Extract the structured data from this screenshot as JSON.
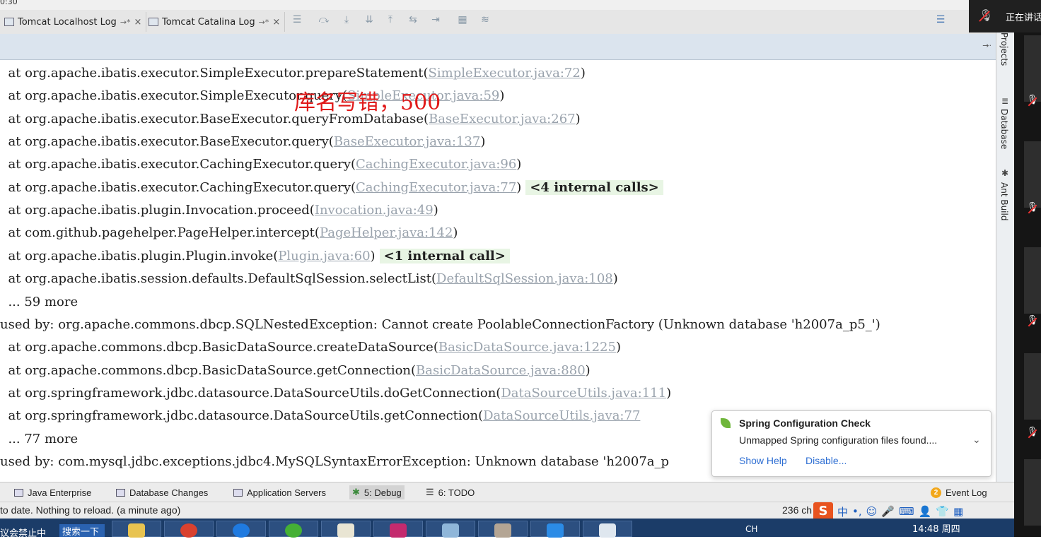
{
  "window": {
    "time_fragment": "0:30"
  },
  "tabs": [
    {
      "label": "Tomcat Localhost Log",
      "pin": "→*",
      "close": "×"
    },
    {
      "label": "Tomcat Catalina Log",
      "pin": "→*",
      "close": "×"
    }
  ],
  "console": {
    "lines": [
      {
        "text": "  at org.apache.ibatis.executor.SimpleExecutor.prepareStatement(",
        "link": "SimpleExecutor.java:72",
        "tail": ")",
        "internal": ""
      },
      {
        "text": "  at org.apache.ibatis.executor.SimpleExecutor.query(",
        "link": "SimpleExecutor.java:59",
        "tail": ")",
        "internal": ""
      },
      {
        "text": "  at org.apache.ibatis.executor.BaseExecutor.queryFromDatabase(",
        "link": "BaseExecutor.java:267",
        "tail": ")",
        "internal": ""
      },
      {
        "text": "  at org.apache.ibatis.executor.BaseExecutor.query(",
        "link": "BaseExecutor.java:137",
        "tail": ")",
        "internal": ""
      },
      {
        "text": "  at org.apache.ibatis.executor.CachingExecutor.query(",
        "link": "CachingExecutor.java:96",
        "tail": ")",
        "internal": ""
      },
      {
        "text": "  at org.apache.ibatis.executor.CachingExecutor.query(",
        "link": "CachingExecutor.java:77",
        "tail": ")",
        "internal": "<4 internal calls>"
      },
      {
        "text": "  at org.apache.ibatis.plugin.Invocation.proceed(",
        "link": "Invocation.java:49",
        "tail": ")",
        "internal": ""
      },
      {
        "text": "  at com.github.pagehelper.PageHelper.intercept(",
        "link": "PageHelper.java:142",
        "tail": ")",
        "internal": ""
      },
      {
        "text": "  at org.apache.ibatis.plugin.Plugin.invoke(",
        "link": "Plugin.java:60",
        "tail": ")",
        "internal": "<1 internal call>"
      },
      {
        "text": "  at org.apache.ibatis.session.defaults.DefaultSqlSession.selectList(",
        "link": "DefaultSqlSession.java:108",
        "tail": ")",
        "internal": ""
      },
      {
        "text": "  ... 59 more",
        "link": "",
        "tail": "",
        "internal": ""
      },
      {
        "text": "used by: org.apache.commons.dbcp.SQLNestedException: Cannot create PoolableConnectionFactory (Unknown database 'h2007a_p5_')",
        "link": "",
        "tail": "",
        "internal": ""
      },
      {
        "text": "  at org.apache.commons.dbcp.BasicDataSource.createDataSource(",
        "link": "BasicDataSource.java:1225",
        "tail": ")",
        "internal": ""
      },
      {
        "text": "  at org.apache.commons.dbcp.BasicDataSource.getConnection(",
        "link": "BasicDataSource.java:880",
        "tail": ")",
        "internal": ""
      },
      {
        "text": "  at org.springframework.jdbc.datasource.DataSourceUtils.doGetConnection(",
        "link": "DataSourceUtils.java:111",
        "tail": ")",
        "internal": ""
      },
      {
        "text": "  at org.springframework.jdbc.datasource.DataSourceUtils.getConnection(",
        "link": "DataSourceUtils.java:77",
        "tail": "",
        "internal": ""
      },
      {
        "text": "  ... 77 more",
        "link": "",
        "tail": "",
        "internal": ""
      },
      {
        "text": "used by: com.mysql.jdbc.exceptions.jdbc4.MySQLSyntaxErrorException: Unknown database 'h2007a_p",
        "link": "",
        "tail": "",
        "internal": ""
      }
    ],
    "annotation": "库名写错，500"
  },
  "right_panel": {
    "projects": "Projects",
    "database": "Database",
    "ant_build": "Ant Build"
  },
  "notification": {
    "title": "Spring Configuration Check",
    "message": "Unmapped Spring configuration files found....",
    "show_help": "Show Help",
    "disable": "Disable..."
  },
  "tool_windows": [
    {
      "label": "Java Enterprise"
    },
    {
      "label": "Database Changes"
    },
    {
      "label": "Application Servers"
    },
    {
      "label": "5: Debug"
    },
    {
      "label": "6: TODO"
    }
  ],
  "event_log": {
    "count": "2",
    "label": "Event Log"
  },
  "status": {
    "message": "to date. Nothing to reload. (a minute ago)",
    "position": "236 ch"
  },
  "meeting": {
    "speaking": "正在讲话"
  },
  "taskbar": {
    "left_text": "议会禁止中",
    "search": "搜索一下",
    "tray": "CH",
    "clock": "14:48 周四"
  },
  "ime": {
    "lang": "中"
  }
}
